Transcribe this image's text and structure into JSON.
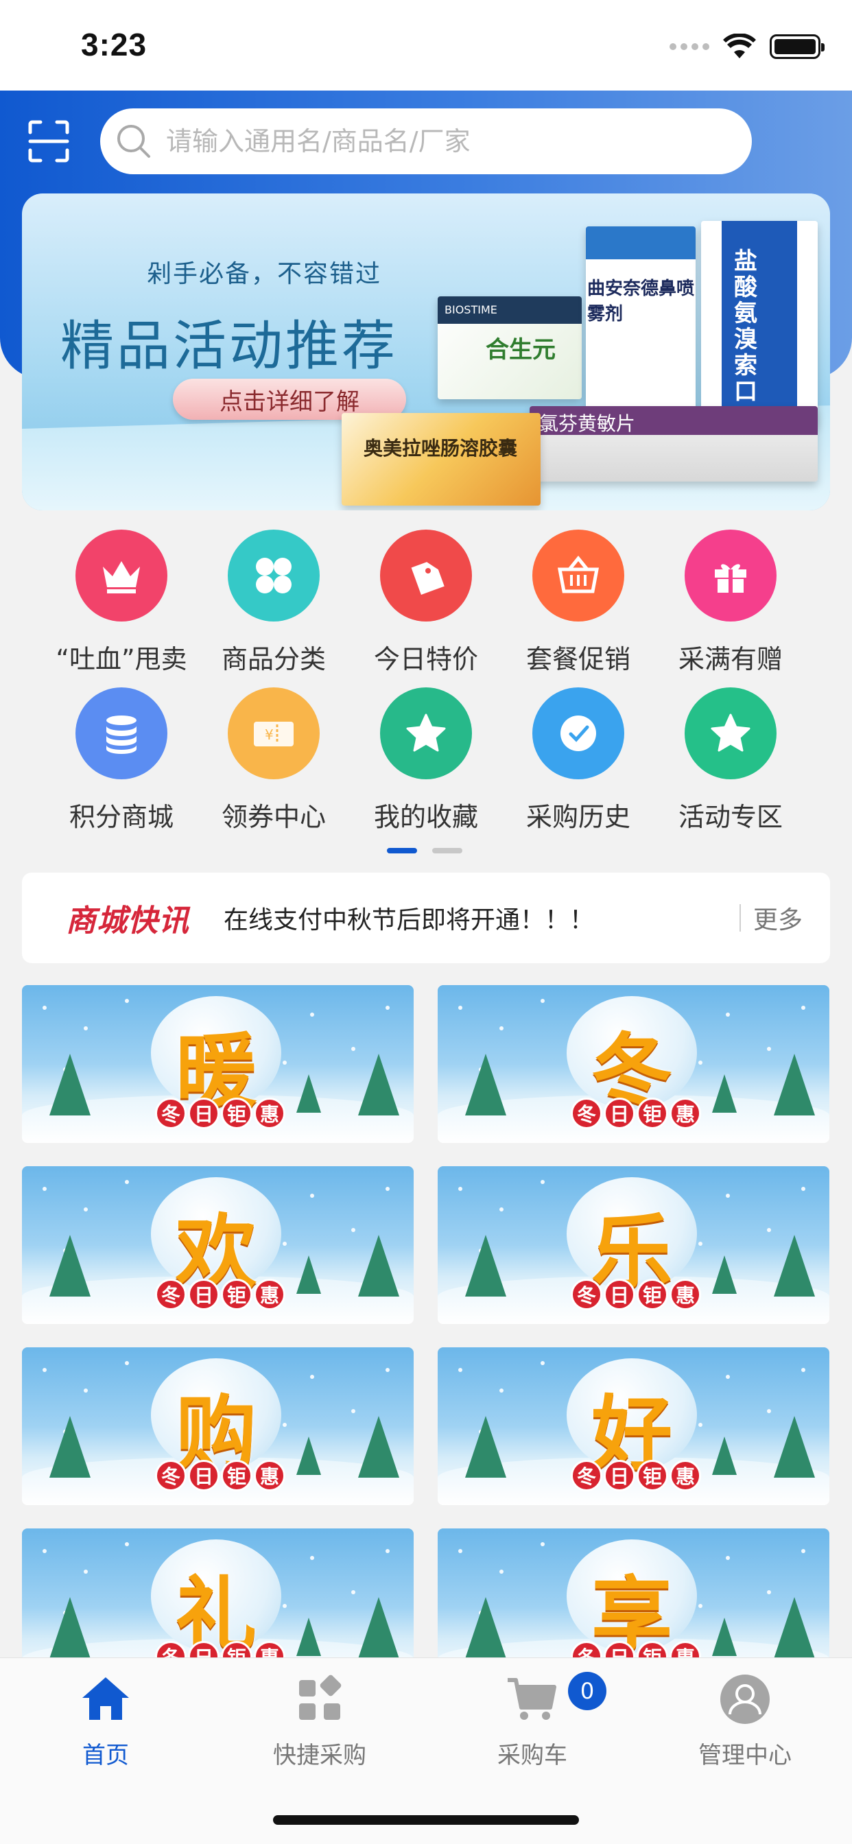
{
  "status_bar": {
    "time": "3:23"
  },
  "search": {
    "placeholder": "请输入通用名/商品名/厂家"
  },
  "banner": {
    "subtitle": "剁手必备，不容错过",
    "title": "精品活动推荐",
    "button": "点击详细了解",
    "products": [
      "合生元",
      "曲安奈德鼻喷雾剂",
      "盐酸氨溴索口服溶液",
      "氯芬黄敏片",
      "奥美拉唑肠溶胶囊"
    ]
  },
  "grid": [
    {
      "label": "“吐血”甩卖",
      "icon": "crown-icon",
      "color": "#f2436a"
    },
    {
      "label": "商品分类",
      "icon": "clover-icon",
      "color": "#35c9c7"
    },
    {
      "label": "今日特价",
      "icon": "price-tag-icon",
      "color": "#f04a4a"
    },
    {
      "label": "套餐促销",
      "icon": "basket-icon",
      "color": "#ff6a3d"
    },
    {
      "label": "采满有赠",
      "icon": "gift-icon",
      "color": "#f53f8c"
    },
    {
      "label": "积分商城",
      "icon": "database-icon",
      "color": "#5b8df2"
    },
    {
      "label": "领券中心",
      "icon": "coupon-icon",
      "color": "#f9b54a"
    },
    {
      "label": "我的收藏",
      "icon": "star-icon",
      "color": "#27b98a"
    },
    {
      "label": "采购历史",
      "icon": "clock-icon",
      "color": "#3aa3ee"
    },
    {
      "label": "活动专区",
      "icon": "star-icon",
      "color": "#25c089"
    }
  ],
  "pager": {
    "active": 0,
    "count": 2
  },
  "news": {
    "logo": "商城快讯",
    "text": "在线支付中秋节后即将开通！！！",
    "more": "更多"
  },
  "promos": [
    {
      "char": "暖",
      "tag": [
        "冬",
        "日",
        "钜",
        "惠"
      ]
    },
    {
      "char": "冬",
      "tag": [
        "冬",
        "日",
        "钜",
        "惠"
      ]
    },
    {
      "char": "欢",
      "tag": [
        "冬",
        "日",
        "钜",
        "惠"
      ]
    },
    {
      "char": "乐",
      "tag": [
        "冬",
        "日",
        "钜",
        "惠"
      ]
    },
    {
      "char": "购",
      "tag": [
        "冬",
        "日",
        "钜",
        "惠"
      ]
    },
    {
      "char": "好",
      "tag": [
        "冬",
        "日",
        "钜",
        "惠"
      ]
    },
    {
      "char": "礼",
      "tag": [
        "冬",
        "日",
        "钜",
        "惠"
      ]
    },
    {
      "char": "享",
      "tag": [
        "冬",
        "日",
        "钜",
        "惠"
      ]
    }
  ],
  "nav": [
    {
      "label": "首页",
      "icon": "home-icon",
      "active": true
    },
    {
      "label": "快捷采购",
      "icon": "quick-buy-icon",
      "active": false
    },
    {
      "label": "采购车",
      "icon": "cart-icon",
      "active": false
    },
    {
      "label": "管理中心",
      "icon": "user-icon",
      "active": false
    }
  ],
  "cart_count": "0",
  "colors": {
    "primary": "#1059d0",
    "news_red": "#d6263a"
  }
}
